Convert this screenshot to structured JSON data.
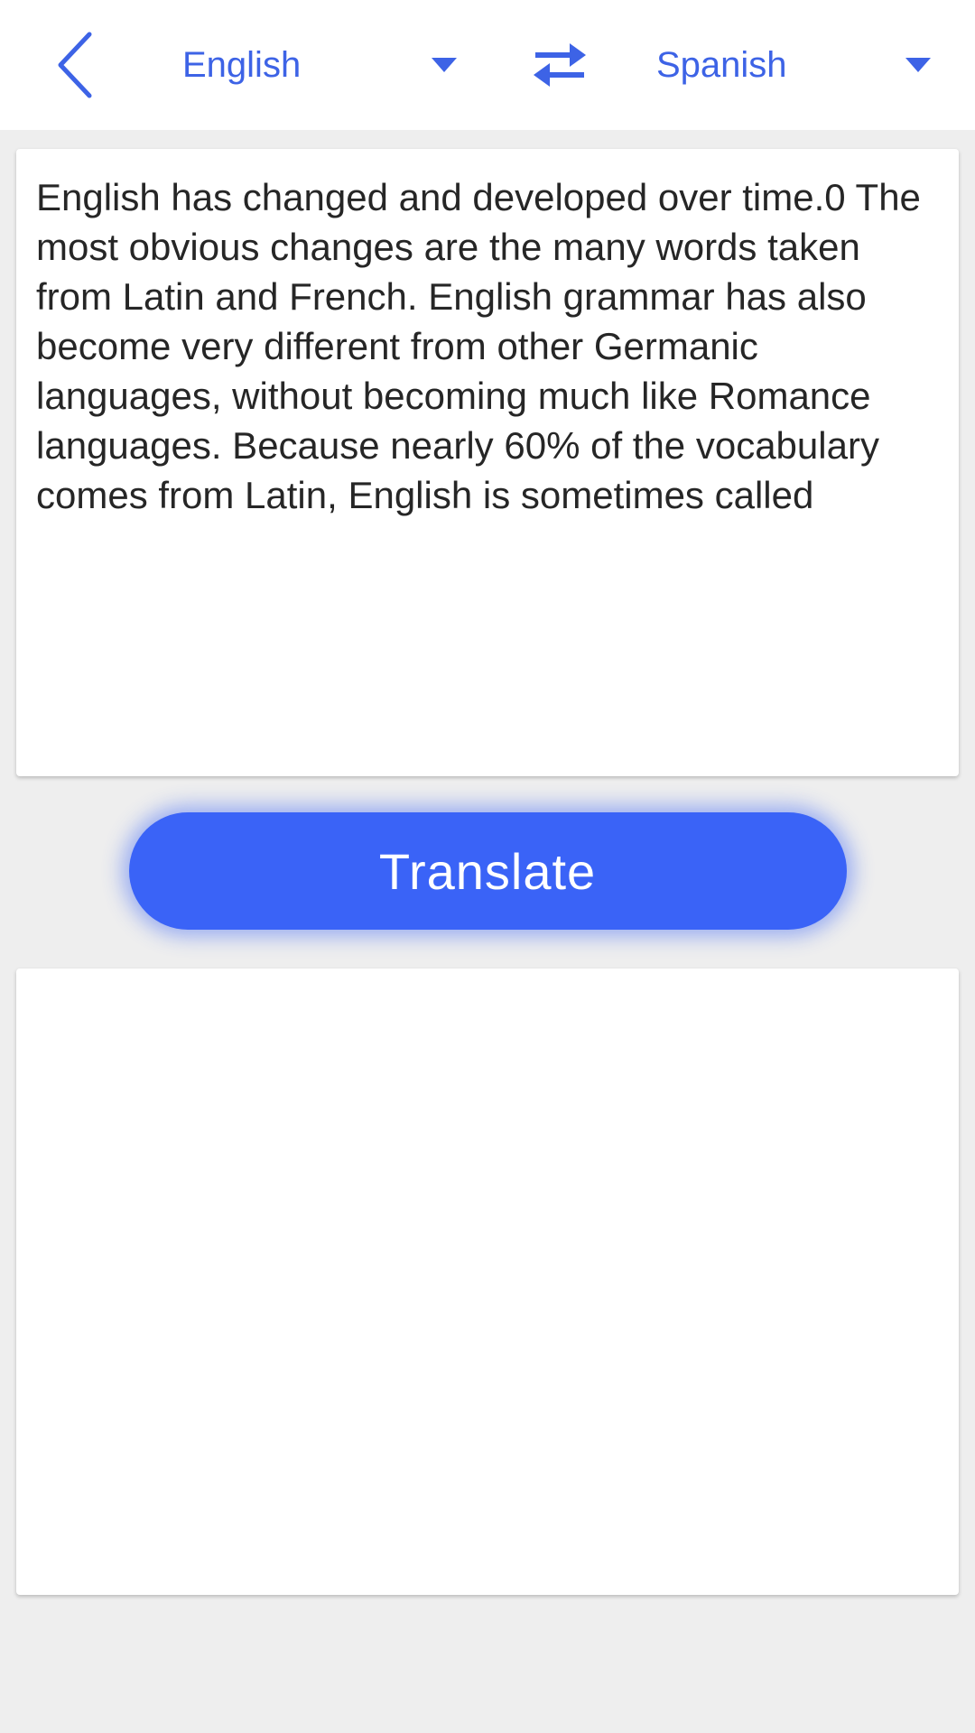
{
  "header": {
    "back_icon": "chevron-left-icon",
    "source_language": "English",
    "target_language": "Spanish",
    "swap_icon": "swap-arrows-icon",
    "dropdown_icon": "caret-down-icon"
  },
  "input": {
    "text": "English has changed and developed over time.0 The\nmost obvious changes are the many words taken\nfrom Latin and French. English grammar has also\nbecome very different from other Germanic\nlanguages, without becoming much like Romance\nlanguages. Because nearly 60% of the vocabulary\ncomes from Latin, English is sometimes called"
  },
  "actions": {
    "translate_label": "Translate"
  },
  "output": {
    "text": ""
  },
  "colors": {
    "accent": "#3d63e6",
    "button": "#3a63f7",
    "background": "#eeeeee",
    "card": "#ffffff"
  }
}
